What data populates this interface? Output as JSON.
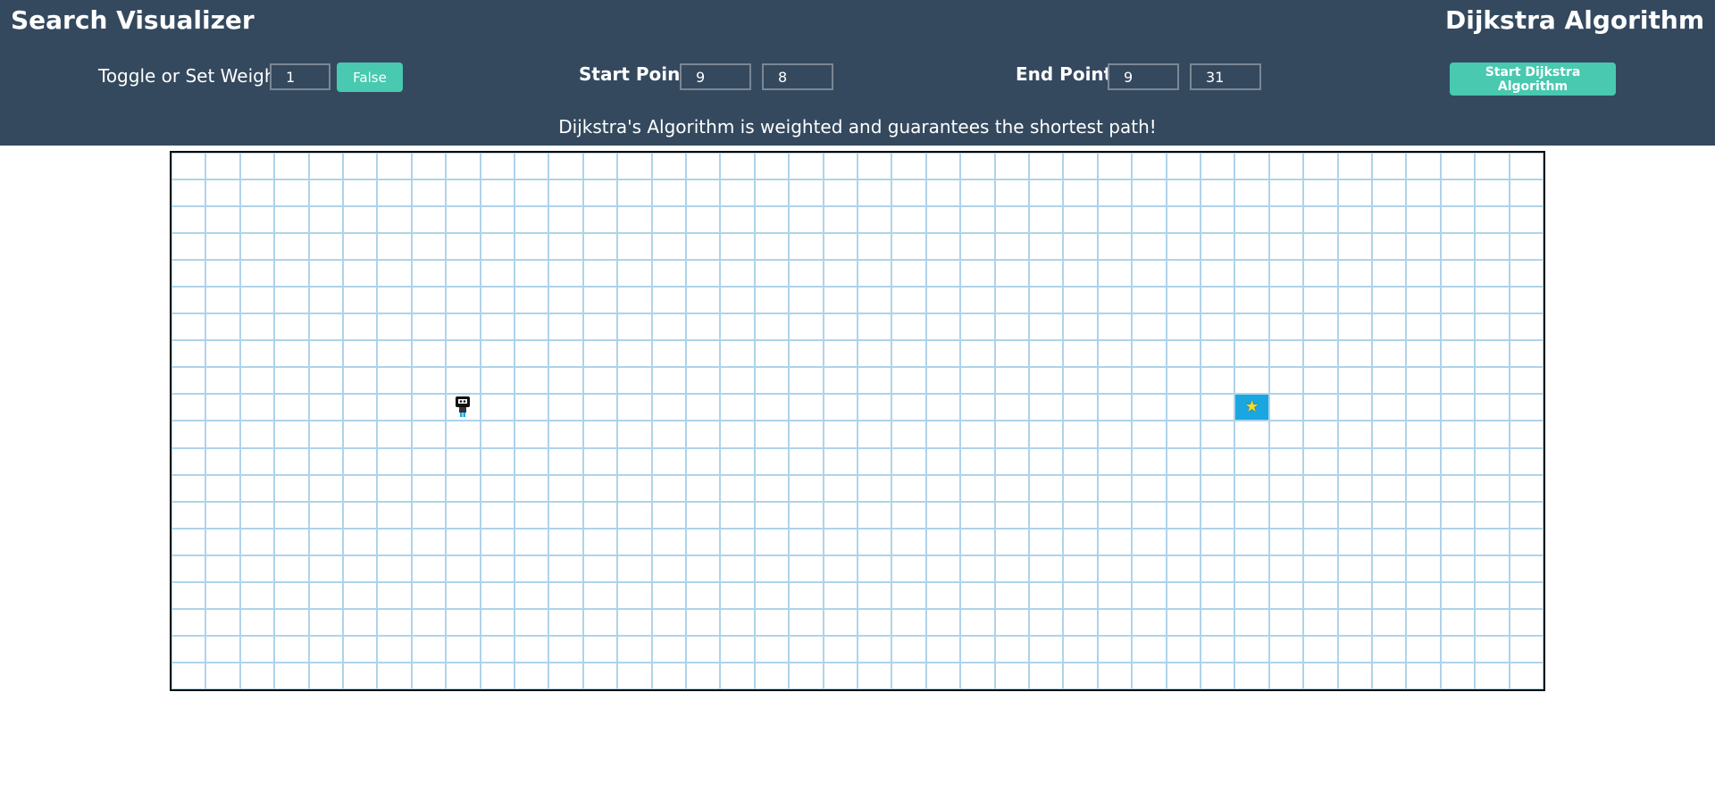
{
  "header": {
    "app_title": "Search Visualizer",
    "algorithm_title": "Dijkstra Algorithm",
    "description": "Dijkstra's Algorithm is weighted and guarantees the shortest path!"
  },
  "controls": {
    "weight_label": "Toggle or Set Weight",
    "weight_value": "1",
    "toggle_label": "False",
    "start_label": "Start Point :",
    "start_row": "9",
    "start_col": "8",
    "end_label": "End Point :",
    "end_row": "9",
    "end_col": "31",
    "run_label": "Start Dijkstra Algorithm"
  },
  "grid": {
    "rows": 20,
    "cols": 40,
    "start": {
      "row": 9,
      "col": 8,
      "icon": "robot-icon"
    },
    "end": {
      "row": 9,
      "col": 31,
      "icon": "star-icon"
    }
  },
  "colors": {
    "header_bg": "#34495e",
    "button_bg": "#48c9b0",
    "grid_line": "#aed3ea",
    "end_cell": "#1aa6e0",
    "star": "#f7dc23"
  }
}
